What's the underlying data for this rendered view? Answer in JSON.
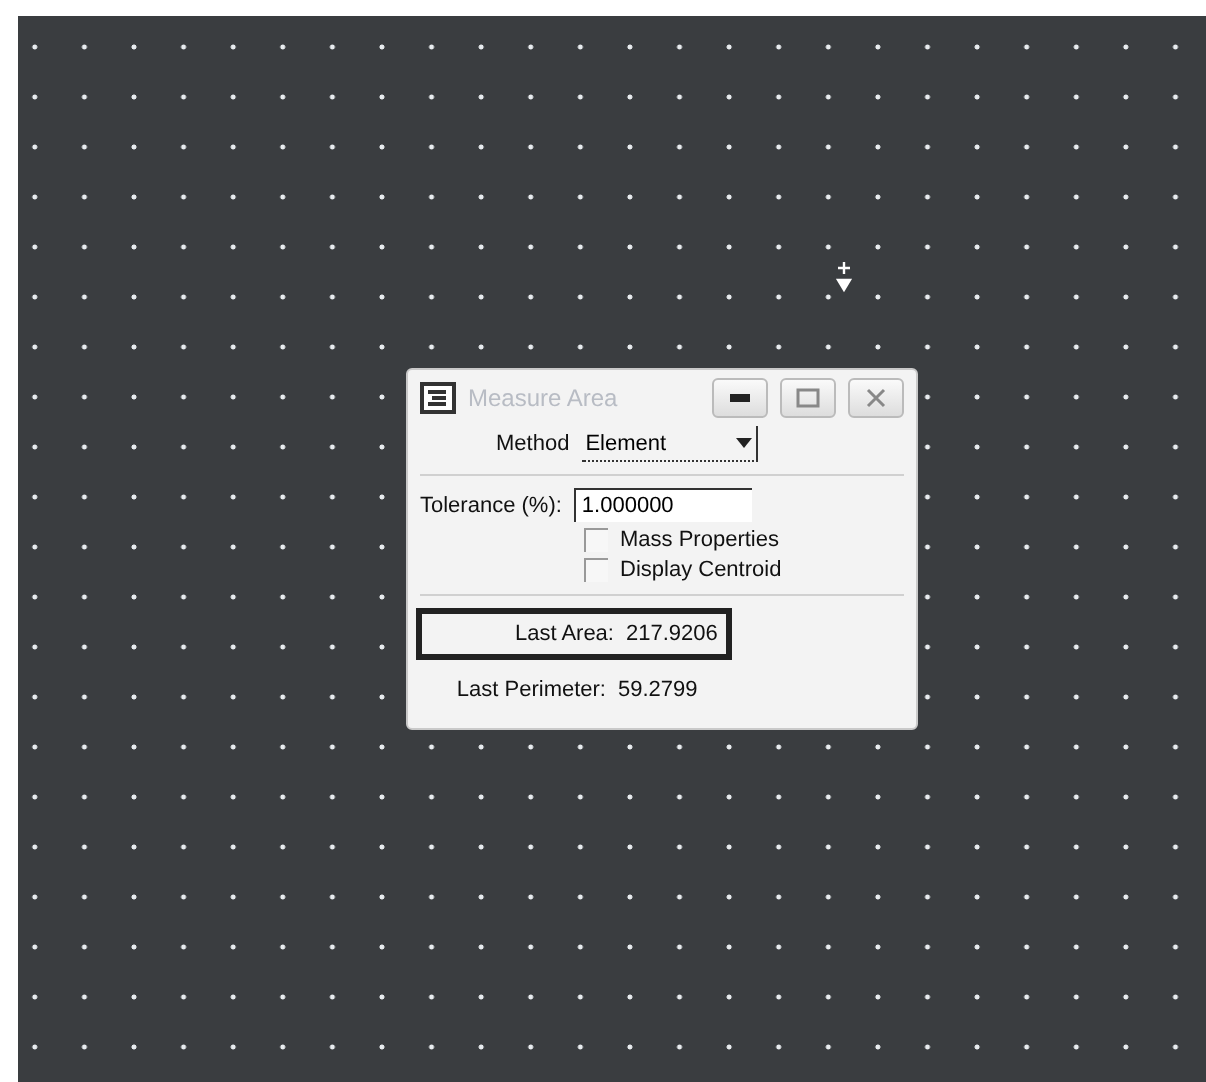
{
  "dialog": {
    "title": "Measure Area",
    "active": false,
    "method": {
      "label": "Method",
      "value": "Element"
    },
    "tolerance": {
      "label": "Tolerance (%):",
      "value": "1.000000"
    },
    "options": [
      {
        "label": "Mass Properties",
        "checked": false
      },
      {
        "label": "Display Centroid",
        "checked": false
      }
    ],
    "results": [
      {
        "label": "Last Area:",
        "value": "217.9206",
        "highlighted": true
      },
      {
        "label": "Last Perimeter:",
        "value": "59.2799",
        "highlighted": false
      }
    ]
  }
}
